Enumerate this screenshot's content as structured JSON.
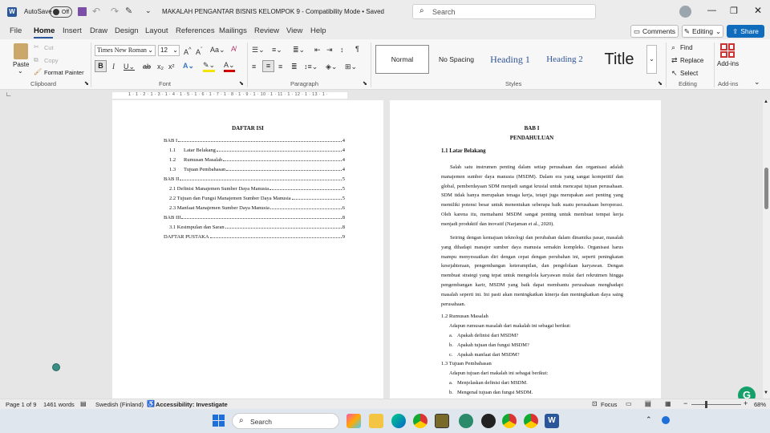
{
  "titlebar": {
    "autosave_label": "AutoSave",
    "autosave_state": "Off",
    "doc_title": "MAKALAH PENGANTAR BISNIS KELOMPOK 9  -  Compatibility Mode  •  Saved",
    "search_placeholder": "Search"
  },
  "tabs": [
    "File",
    "Home",
    "Insert",
    "Draw",
    "Design",
    "Layout",
    "References",
    "Mailings",
    "Review",
    "View",
    "Help"
  ],
  "tabs_active": "Home",
  "right_buttons": {
    "comments": "Comments",
    "editing": "Editing",
    "share": "Share"
  },
  "clipboard": {
    "paste": "Paste",
    "cut": "Cut",
    "copy": "Copy",
    "format_painter": "Format Painter",
    "label": "Clipboard"
  },
  "font": {
    "name": "Times New Roman",
    "size": "12",
    "label": "Font"
  },
  "paragraph": {
    "label": "Paragraph"
  },
  "styles": {
    "items": [
      "Normal",
      "No Spacing",
      "Heading 1",
      "Heading 2",
      "Title"
    ],
    "label": "Styles"
  },
  "editing": {
    "find": "Find",
    "replace": "Replace",
    "select": "Select",
    "label": "Editing"
  },
  "addins": {
    "button": "Add-ins",
    "label": "Add-ins"
  },
  "ruler_text": "1 · 1 · 2 · 1 · 3 · 1 · 4 · 1 · 5 · 1 · 6 · 1 · 7 · 1 · 8 · 1 · 9 · 1 · 10 · 1 · 11 · 1 · 12 · 1 · 13 · 1 ·",
  "toc": {
    "title": "DAFTAR ISI",
    "entries": [
      {
        "num": "",
        "text": "BAB I",
        "page": "4"
      },
      {
        "num": "1.1",
        "text": "Latar Belakang",
        "page": "4"
      },
      {
        "num": "1.2",
        "text": "Rumusan Masalah",
        "page": "4"
      },
      {
        "num": "1.3",
        "text": "Tujuan Pembahasan",
        "page": "4"
      },
      {
        "num": "",
        "text": "BAB II",
        "page": "5"
      },
      {
        "num": "",
        "text": "2.1 Definisi Manajemen Sumber Daya Manusia",
        "page": "5"
      },
      {
        "num": "",
        "text": "2.2 Tujuan dan Fungsi Manajemen Sumber Daya Manusia",
        "page": "5"
      },
      {
        "num": "",
        "text": "2.3 Manfaat Manajemen Sumber Daya Manusia",
        "page": "6"
      },
      {
        "num": "",
        "text": "BAB III",
        "page": "8"
      },
      {
        "num": "",
        "text": "3.1 Kesimpulan dan Saran",
        "page": "8"
      },
      {
        "num": "",
        "text": "DAFTAR PUSTAKA",
        "page": "9"
      }
    ]
  },
  "doc": {
    "chapter": "BAB I",
    "chapter_title": "PENDAHULUAN",
    "h1": "1.1 Latar Belakang",
    "p1": "Salah satu instrumen penting dalam setiap perusahaan dan organisasi adalah manajemen sumber daya manusia (MSDM). Dalam era yang sangat kompetitif dan global, pemberdayaan SDM menjadi sangat krusial untuk mencapai tujuan perusahaan. SDM tidak hanya merupakan tenaga kerja, tetapi juga merupakan aset penting yang memiliki potensi besar untuk menentukan seberapa baik suatu perusahaan beroperasi. Oleh karena itu, memahami MSDM sangat penting untuk membuat tempat kerja menjadi produktif dan inovatif (Narjaman et al., 2020).",
    "p2": "Seiring dengan kemajuan teknologi dan perubahan dalam dinamika pasar, masalah yang dihadapi manajer sumber daya manusia semakin kompleks. Organisasi harus mampu menyesuaikan diri dengan cepat dengan perubahan ini, seperti peningkatan kesejahteraan, pengembangan keterampilan, dan pengelolaan karyawan. Dengan membuat strategi yang tepat untuk mengelola karyawan mulai dari rekrutmen hingga pengembangan karir, MSDM yang baik dapat membantu perusahaan menghadapi masalah seperti ini. Ini pasti akan meningkatkan kinerja dan meningkatkan daya saing perusahaan.",
    "h2": "1.2 Rumusan Masalah",
    "h2_intro": "Adapun rumusan masalah dari makalah ini sebagai berikut:",
    "h2_items": [
      {
        "m": "a.",
        "t": "Apakah definisi dari MSDM?"
      },
      {
        "m": "b.",
        "t": "Apakah tujuan dan fungsi MSDM?"
      },
      {
        "m": "c.",
        "t": "Apakah manfaat dari MSDM?"
      }
    ],
    "h3": "1.3 Tujuan Pembahasan",
    "h3_intro": "Adapun tujuan dari makalah ini sebagai berikut:",
    "h3_items": [
      {
        "m": "a.",
        "t": "Menjelaskan definisi dari MSDM."
      },
      {
        "m": "b.",
        "t": "Mengenal tujuan dan fungsi MSDM."
      }
    ]
  },
  "status": {
    "page": "Page 1 of 9",
    "words": "1461 words",
    "language": "Swedish (Finland)",
    "accessibility": "Accessibility: Investigate",
    "focus": "Focus",
    "zoom": "68%"
  },
  "taskbar": {
    "search": "Search"
  },
  "colors": {
    "word_blue": "#2b579a",
    "share_blue": "#0f6cbd",
    "heading_blue": "#2f5496"
  }
}
